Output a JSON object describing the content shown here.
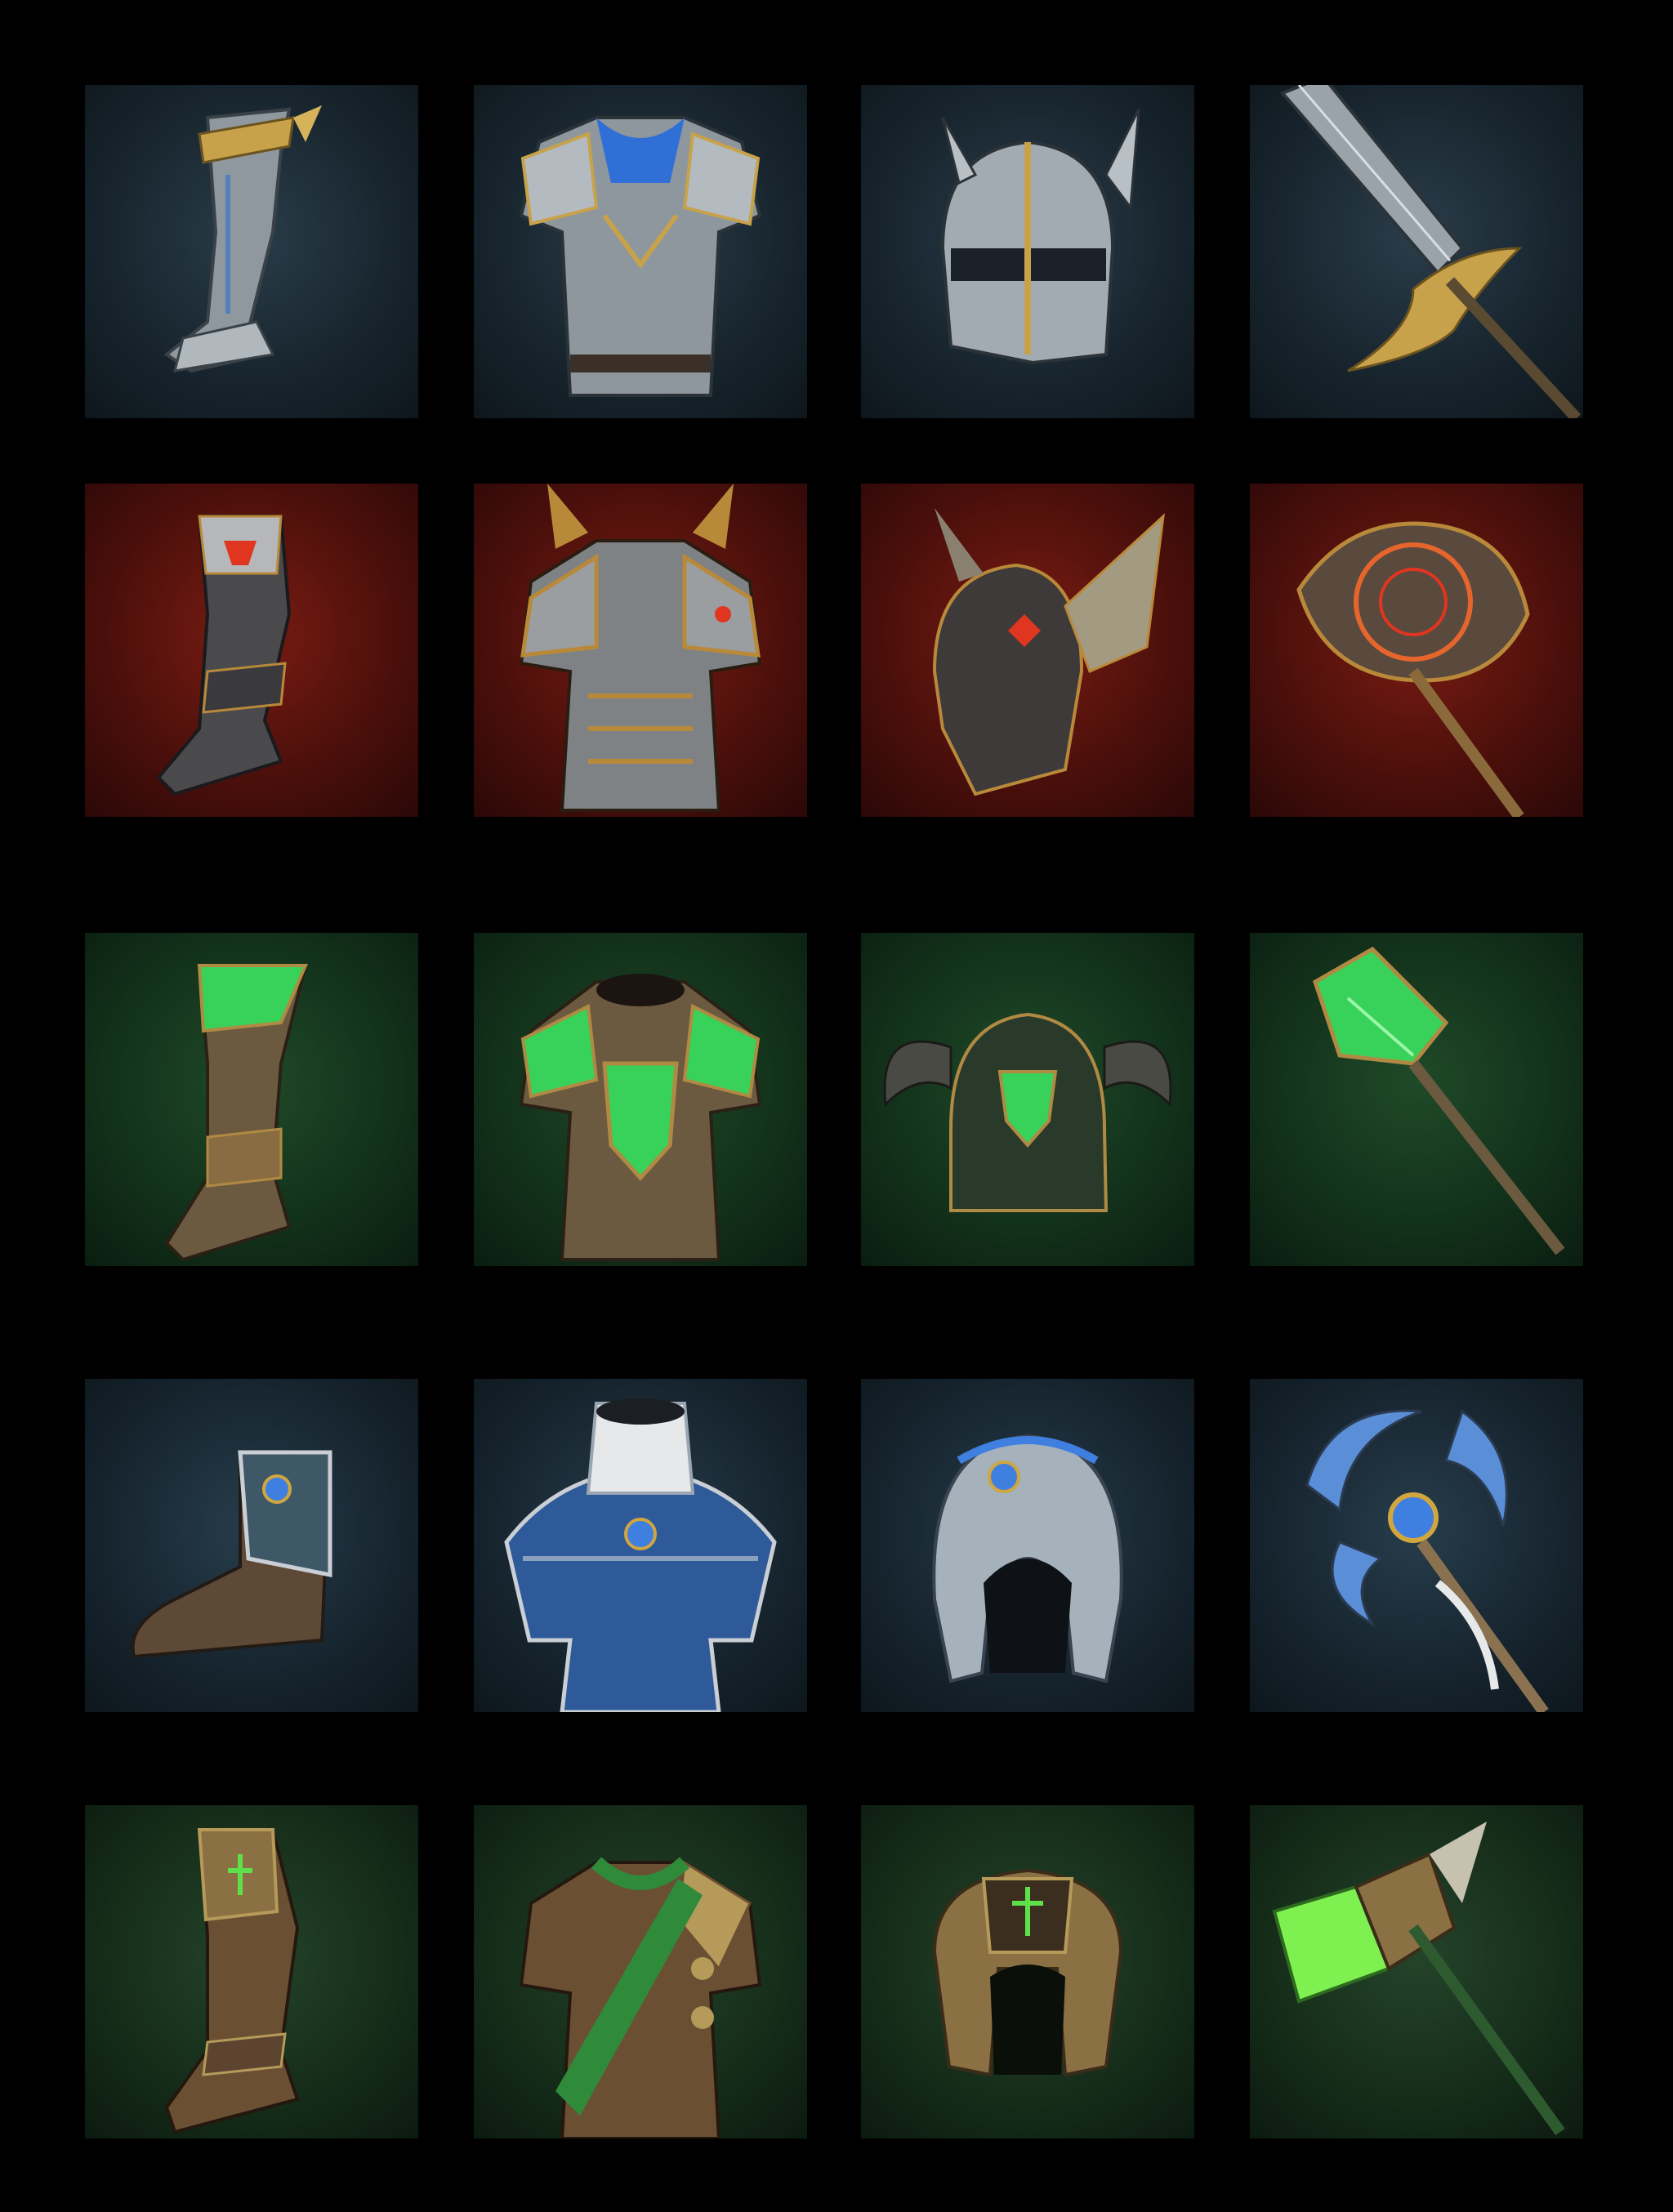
{
  "grid": {
    "rows": 5,
    "columns": 4,
    "sets": [
      {
        "theme": "steel",
        "palette": {
          "metal": "#a9b2b8",
          "trim": "#c8a24a",
          "accent": "#2f6fd6"
        },
        "items": [
          "boot-icon",
          "chestplate-icon",
          "helmet-icon",
          "sword-icon"
        ]
      },
      {
        "theme": "crimson",
        "palette": {
          "metal": "#8d8f92",
          "trim": "#b9893a",
          "accent": "#e0351f"
        },
        "items": [
          "boot-icon",
          "chestplate-icon",
          "winged-helmet-icon",
          "axe-icon"
        ]
      },
      {
        "theme": "emerald",
        "palette": {
          "metal": "#6b5a40",
          "trim": "#b08a43",
          "accent": "#38d25a"
        },
        "items": [
          "boot-icon",
          "chestplate-icon",
          "horned-helmet-icon",
          "mace-icon"
        ]
      },
      {
        "theme": "arcane",
        "palette": {
          "metal": "#9aa7b3",
          "trim": "#d2a63e",
          "accent": "#3f7fe0"
        },
        "items": [
          "boot-icon",
          "robe-icon",
          "hood-helmet-icon",
          "staff-icon"
        ]
      },
      {
        "theme": "verdant",
        "palette": {
          "metal": "#6a4f33",
          "trim": "#b59a5a",
          "accent": "#5ee04a"
        },
        "items": [
          "boot-icon",
          "tunic-icon",
          "circlet-helmet-icon",
          "hammer-icon"
        ]
      }
    ]
  }
}
